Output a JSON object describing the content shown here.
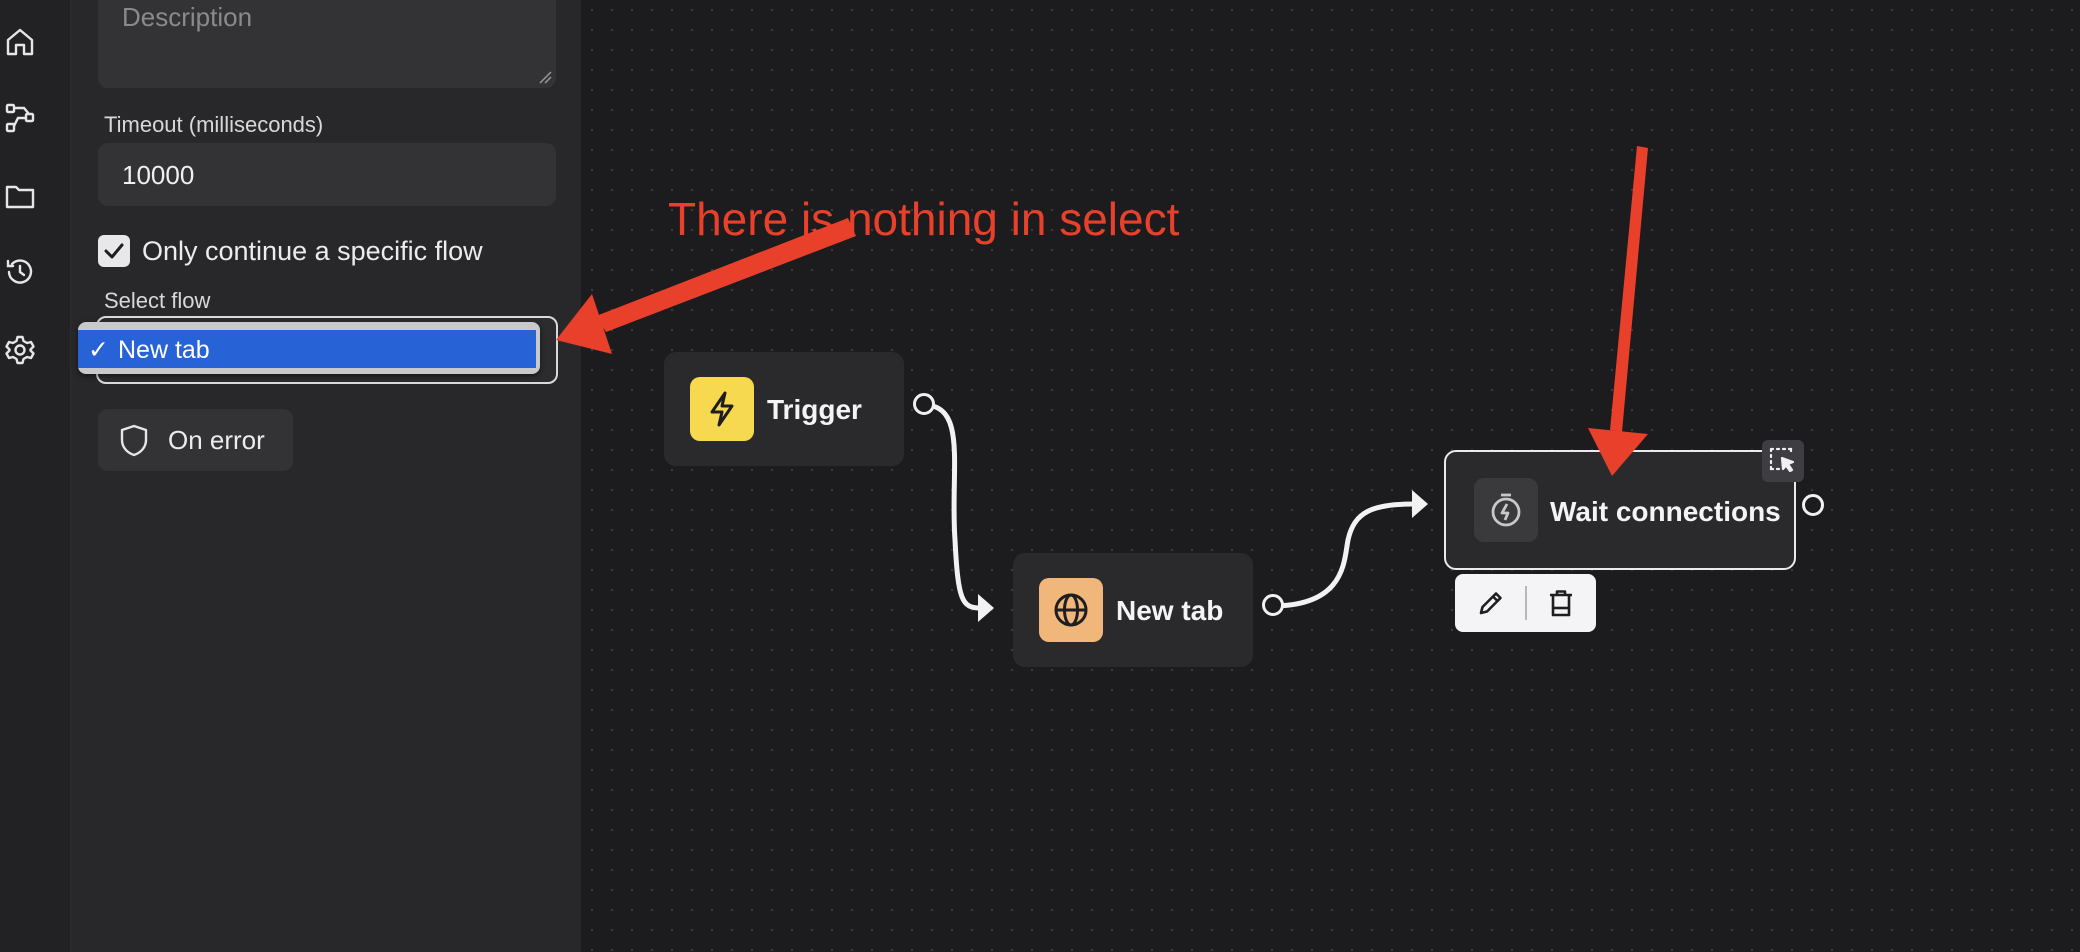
{
  "sidebar": {
    "icons": [
      "home-icon",
      "workflow-icon",
      "folder-icon",
      "history-icon",
      "settings-icon"
    ]
  },
  "panel": {
    "description_placeholder": "Description",
    "timeout_label": "Timeout (milliseconds)",
    "timeout_value": "10000",
    "only_continue_label": "Only continue a specific flow",
    "only_continue_checked": true,
    "select_flow_label": "Select flow",
    "select_option": "New tab",
    "on_error_label": "On error"
  },
  "canvas": {
    "nodes": [
      {
        "id": "trigger",
        "label": "Trigger",
        "icon": "lightning-icon",
        "color": "#f6d94e"
      },
      {
        "id": "new-tab",
        "label": "New tab",
        "icon": "globe-icon",
        "color": "#f0b67a"
      },
      {
        "id": "wait-connections",
        "label": "Wait connections",
        "icon": "stopwatch-icon",
        "color": "#3a3a3d"
      }
    ],
    "toolbar": [
      "pencil-icon",
      "trash-icon"
    ]
  },
  "annotation": {
    "text": "There is nothing in select",
    "color": "#e8402a"
  }
}
